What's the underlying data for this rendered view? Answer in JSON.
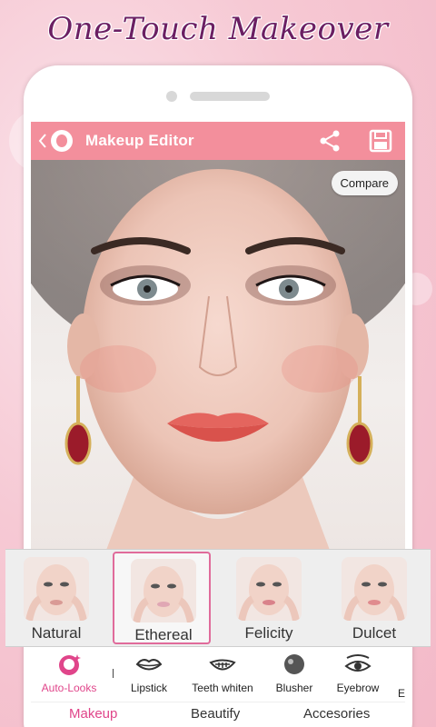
{
  "promo": {
    "title": "One-Touch Makeover"
  },
  "appbar": {
    "title": "Makeup Editor",
    "back_icon": "chevron-left-icon",
    "logo": "app-face-logo",
    "share_icon": "share-icon",
    "save_icon": "floppy-disk-icon",
    "color": "#f38f9c"
  },
  "photo": {
    "compare_label": "Compare"
  },
  "looks": [
    {
      "label": "Natural",
      "selected": false
    },
    {
      "label": "Ethereal",
      "selected": true
    },
    {
      "label": "Felicity",
      "selected": false
    },
    {
      "label": "Dulcet",
      "selected": false
    }
  ],
  "tools": [
    {
      "label": "Auto-Looks",
      "icon": "face-sparkle-icon",
      "active": true
    },
    {
      "label": "Lipstick",
      "icon": "lips-icon",
      "active": false
    },
    {
      "label": "Teeth whiten",
      "icon": "smile-teeth-icon",
      "active": false
    },
    {
      "label": "Blusher",
      "icon": "blush-icon",
      "active": false
    },
    {
      "label": "Eyebrow",
      "icon": "eye-icon",
      "active": false
    },
    {
      "label": "E",
      "icon": "",
      "active": false
    }
  ],
  "tabs": [
    {
      "label": "Makeup",
      "active": true
    },
    {
      "label": "Beautify",
      "active": false
    },
    {
      "label": "Accesories",
      "active": false
    }
  ],
  "colors": {
    "accent": "#e0458a",
    "selected_border": "#e06b9b"
  }
}
